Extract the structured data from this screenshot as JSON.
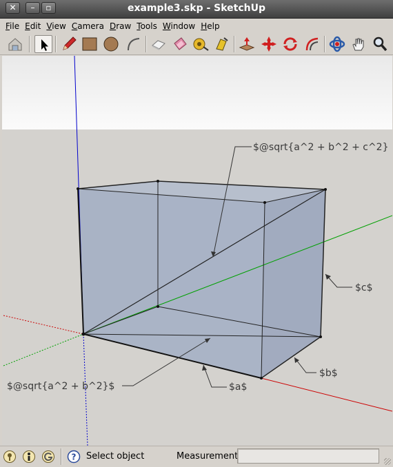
{
  "window": {
    "title": "example3.skp - SketchUp",
    "close_glyph": "✕",
    "minimize_glyph": "–",
    "maximize_glyph": "▫"
  },
  "menu": [
    {
      "underline": "F",
      "rest": "ile"
    },
    {
      "underline": "E",
      "rest": "dit"
    },
    {
      "underline": "V",
      "rest": "iew"
    },
    {
      "underline": "C",
      "rest": "amera"
    },
    {
      "underline": "D",
      "rest": "raw"
    },
    {
      "underline": "T",
      "rest": "ools"
    },
    {
      "underline": "W",
      "rest": "indow"
    },
    {
      "underline": "H",
      "rest": "elp"
    }
  ],
  "toolbar": {
    "tools": [
      "house-icon",
      "select-arrow-icon",
      "pencil-icon",
      "rectangle-icon",
      "circle-icon",
      "arc-icon",
      "eraser-icon",
      "paint-bucket-icon",
      "tape-measure-icon",
      "paint-icon",
      "push-pull-icon",
      "move-icon",
      "rotate-icon",
      "offset-icon",
      "orbit-icon",
      "pan-hand-icon",
      "zoom-icon"
    ],
    "active_tool": "select-arrow-icon"
  },
  "viewport": {
    "sky_color": "#f2f2f2",
    "ground_color": "#d4d2ce",
    "face_color": "#a8b2c4",
    "axis_colors": {
      "red": "#cc0000",
      "green": "#00a000",
      "blue": "#0000cc"
    },
    "labels": {
      "diag3d": "$@sqrt{a^2 + b^2 + c^2}",
      "c": "$c$",
      "b": "$b$",
      "a": "$a$",
      "diag2d": "$@sqrt{a^2 + b^2}$"
    }
  },
  "status": {
    "icons": [
      "geo-location-icon",
      "credits-icon",
      "google-icon"
    ],
    "help_icon": "help-icon",
    "text": "Select object",
    "measurements_label": "Measurements",
    "measurements_value": ""
  }
}
